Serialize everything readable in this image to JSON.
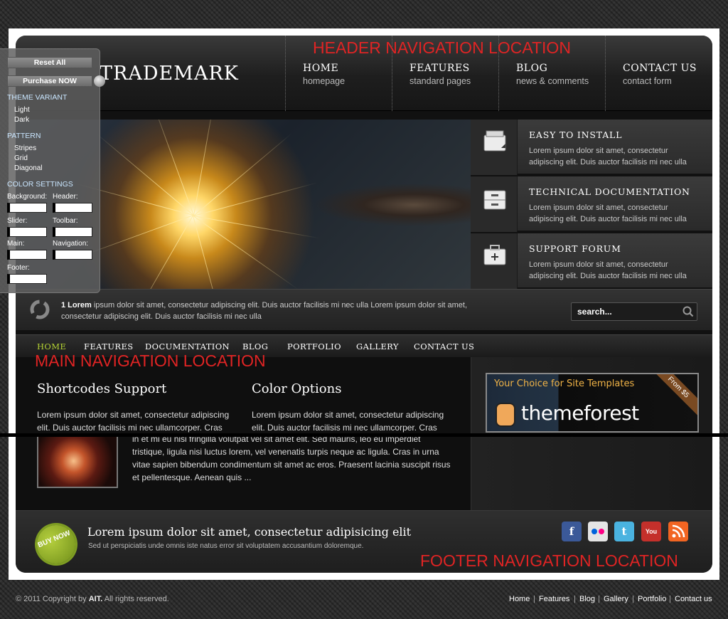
{
  "header": {
    "logo": "TRADEMARK",
    "annotation": "HEADER NAVIGATION LOCATION",
    "nav": [
      {
        "title": "HOME",
        "sub": "homepage"
      },
      {
        "title": "FEATURES",
        "sub": "standard pages"
      },
      {
        "title": "BLOG",
        "sub": "news & comments"
      },
      {
        "title": "CONTACT US",
        "sub": "contact form"
      }
    ]
  },
  "features": [
    {
      "icon": "inbox-icon",
      "title": "EASY TO INSTALL",
      "text": "Lorem ipsum dolor sit amet, consectetur adipiscing elit. Duis auctor facilisis mi nec ulla"
    },
    {
      "icon": "cabinet-icon",
      "title": "TECHNICAL DOCUMENTATION",
      "text": "Lorem ipsum dolor sit amet, consectetur adipiscing elit. Duis auctor facilisis mi nec ulla"
    },
    {
      "icon": "toolbox-icon",
      "title": "SUPPORT FORUM",
      "text": "Lorem ipsum dolor sit amet, consectetur adipiscing elit. Duis auctor facilisis mi nec ulla"
    }
  ],
  "ticker": {
    "label": "1 Lorem",
    "text": " ipsum dolor sit amet, consectetur adipiscing elit. Duis auctor facilisis mi nec ulla Lorem ipsum dolor sit amet, consectetur adipiscing elit. Duis auctor facilisis mi nec ulla"
  },
  "search": {
    "placeholder": "search..."
  },
  "mainnav": {
    "items": [
      "HOME",
      "FEATURES",
      "DOCUMENTATION",
      "BLOG",
      "PORTFOLIO",
      "GALLERY",
      "CONTACT US"
    ],
    "active": "HOME",
    "annotation": "MAIN NAVIGATION LOCATION"
  },
  "content": {
    "col1": {
      "title": "Shortcodes Support",
      "text": "Lorem ipsum dolor sit amet, consectetur adipiscing elit. Duis auctor facilisis mi nec ullamcorper. Cras"
    },
    "col2": {
      "title": "Color Options",
      "text": "Lorem ipsum dolor sit amet, consectetur adipiscing elit. Duis auctor facilisis mi nec ullamcorper. Cras"
    },
    "para": "in et mi eu nisi fringilla volutpat vel sit amet elit. Sed mauris, leo eu imperdiet tristique, ligula nisi luctus lorem, vel venenatis turpis neque ac ligula. Cras in urna vitae sapien bibendum condimentum sit amet ac eros. Praesent lacinia suscipit risus et pellentesque. Aenean quis ..."
  },
  "ad": {
    "tagline": "Your Choice for Site Templates",
    "brand": "themeforest",
    "tag": "From $5"
  },
  "footer": {
    "badge": "BUY NOW",
    "title": "Lorem ipsum dolor sit amet, consectetur adipisicing elit",
    "sub": "Sed ut perspiciatis unde omnis iste natus error sit voluptatem accusantium doloremque.",
    "annotation": "FOOTER NAVIGATION LOCATION",
    "social": [
      {
        "name": "facebook",
        "glyph": "f",
        "color": "#3b5998"
      },
      {
        "name": "flickr",
        "glyph": "••",
        "color": "#e5e5e5"
      },
      {
        "name": "twitter",
        "glyph": "t",
        "color": "#4ab3e0"
      },
      {
        "name": "youtube",
        "glyph": "You",
        "color": "#c4302b"
      },
      {
        "name": "rss",
        "glyph": "))",
        "color": "#f26522"
      }
    ]
  },
  "bottom": {
    "copyright_pre": "© 2011 Copyright by ",
    "copyright_brand": "AIT.",
    "copyright_post": " All rights reserved.",
    "links": [
      "Home",
      "Features",
      "Blog",
      "Gallery",
      "Portfolio",
      "Contact us"
    ],
    "separator": "|"
  },
  "theme_panel": {
    "reset": "Reset All",
    "purchase": "Purchase NOW",
    "variant_label": "THEME VARIANT",
    "variants": [
      "Light",
      "Dark"
    ],
    "pattern_label": "PATTERN",
    "patterns": [
      "Stripes",
      "Grid",
      "Diagonal"
    ],
    "color_label": "COLOR SETTINGS",
    "colors": [
      "Background:",
      "Header:",
      "Slider:",
      "Toolbar:",
      "Main:",
      "Navigation:",
      "Footer:"
    ]
  }
}
